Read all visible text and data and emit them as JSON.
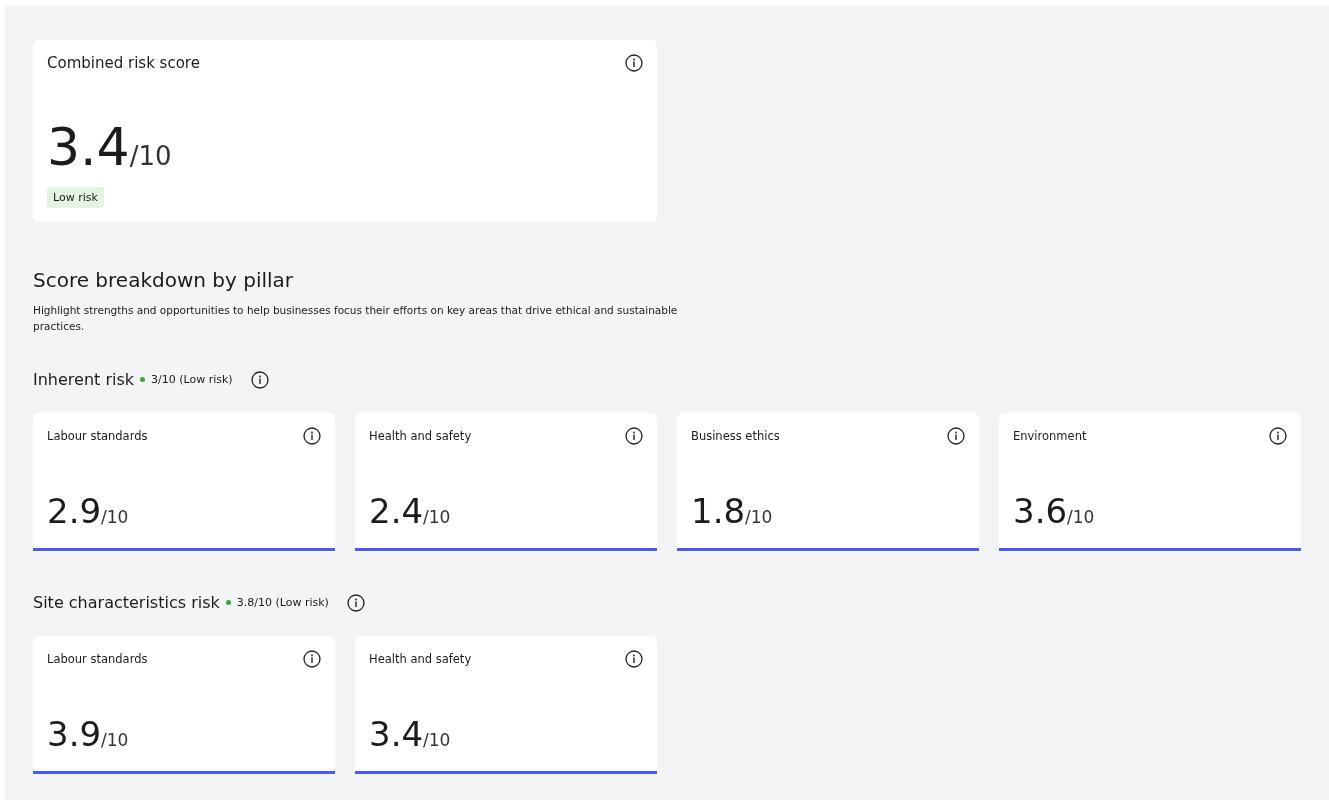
{
  "combined": {
    "title": "Combined risk score",
    "score": "3.4",
    "scale": "/10",
    "badge": "Low risk"
  },
  "breakdown": {
    "title": "Score breakdown by pillar",
    "description": "Highlight strengths and opportunities to help businesses focus their efforts on key areas that drive ethical and sustainable practices."
  },
  "sections": [
    {
      "title": "Inherent risk",
      "status": "3/10 (Low risk)",
      "color": "#3aa53a",
      "cards": [
        {
          "label": "Labour standards",
          "score": "2.9",
          "scale": "/10"
        },
        {
          "label": "Health and safety",
          "score": "2.4",
          "scale": "/10"
        },
        {
          "label": "Business ethics",
          "score": "1.8",
          "scale": "/10"
        },
        {
          "label": "Environment",
          "score": "3.6",
          "scale": "/10"
        }
      ]
    },
    {
      "title": "Site characteristics risk",
      "status": "3.8/10 (Low risk)",
      "color": "#3aa53a",
      "cards": [
        {
          "label": "Labour standards",
          "score": "3.9",
          "scale": "/10"
        },
        {
          "label": "Health and safety",
          "score": "3.4",
          "scale": "/10"
        }
      ]
    }
  ]
}
